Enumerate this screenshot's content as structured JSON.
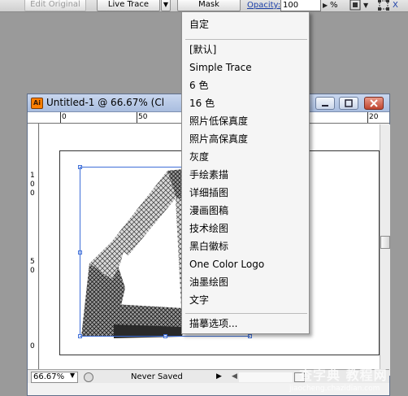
{
  "control_bar": {
    "edit_original": "Edit Original",
    "live_trace": "Live Trace",
    "mask": "Mask",
    "opacity_label": "Opacity:",
    "opacity_value": "100",
    "percent_sign": "%"
  },
  "menu": {
    "items": [
      "自定",
      "[默认]",
      "Simple Trace",
      "6 色",
      "16 色",
      "照片低保真度",
      "照片高保真度",
      "灰度",
      "手绘素描",
      "详细插图",
      "漫画图稿",
      "技术绘图",
      "黑白徽标",
      "One Color Logo",
      "油墨绘图",
      "文字",
      "描摹选项..."
    ]
  },
  "document": {
    "title": "Untitled-1 @ 66.67% (Cl",
    "app_icon": "Ai",
    "ruler_h": {
      "left": "0",
      "middle": "50",
      "right": "20"
    },
    "ruler_v": {
      "a": "1",
      "b": "0",
      "c": "0",
      "d": "5",
      "e": "0",
      "f": "0"
    }
  },
  "status_bar": {
    "zoom": "66.67%",
    "save_state": "Never Saved"
  },
  "watermark": {
    "line1": "查字典 教程网",
    "line2": "jiaocheng.chazidian.com"
  },
  "colors": {
    "accent": "#3f6fd8",
    "titlebar": "#b7c8e6"
  }
}
